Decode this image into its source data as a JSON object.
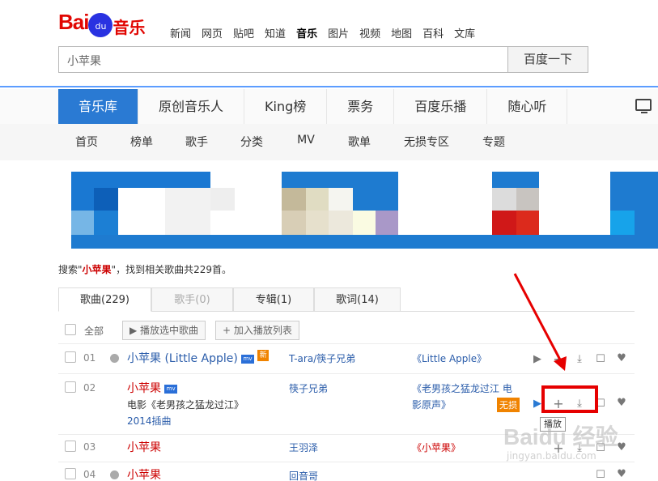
{
  "logo": {
    "brand": "Bai",
    "paw": "du",
    "suffix": "音乐"
  },
  "topnav": [
    "新闻",
    "网页",
    "贴吧",
    "知道",
    "音乐",
    "图片",
    "视频",
    "地图",
    "百科",
    "文库"
  ],
  "topnav_current": "音乐",
  "search": {
    "value": "小苹果",
    "button": "百度一下"
  },
  "mainnav": [
    "音乐库",
    "原创音乐人",
    "King榜",
    "票务",
    "百度乐播",
    "随心听"
  ],
  "subnav": [
    "首页",
    "榜单",
    "歌手",
    "分类",
    "MV",
    "歌单",
    "无损专区",
    "专题"
  ],
  "summary": {
    "prefix": "搜索\"",
    "query": "小苹果",
    "suffix": "\"，找到相关歌曲共229首。"
  },
  "tabs": [
    "歌曲(229)",
    "歌手(0)",
    "专辑(1)",
    "歌词(14)"
  ],
  "actions": {
    "select_all": "全部",
    "play_selected": "播放选中歌曲",
    "add_playlist": "加入播放列表"
  },
  "songs": [
    {
      "num": "01",
      "title": "小苹果 (Little Apple)",
      "artist": "T-ara/筷子兄弟",
      "album": "《Little Apple》",
      "mv": "mv",
      "new": "新"
    },
    {
      "num": "02",
      "title": "小苹果",
      "sub1": "电影《老男孩之猛龙过江》",
      "sub2": "2014插曲",
      "artist": "筷子兄弟",
      "album1": "《老男孩之猛龙过江 电",
      "album2": "影原声》",
      "mv": "mv",
      "lossless": "无损"
    },
    {
      "num": "03",
      "title": "小苹果",
      "artist": "王羽泽",
      "album": "《小苹果》"
    },
    {
      "num": "04",
      "title": "小苹果",
      "artist": "回音哥"
    }
  ],
  "tooltip": "播放",
  "watermark": {
    "main": "Baidu 经验",
    "sub": "jingyan.baidu.com"
  },
  "colors": {
    "accent": "#2a7ad3",
    "red": "#e60000",
    "song_red": "#cc0000"
  },
  "icons": [
    "play-icon",
    "add-icon",
    "download-icon",
    "box-icon",
    "heart-icon",
    "tv-icon",
    "globe-icon"
  ]
}
